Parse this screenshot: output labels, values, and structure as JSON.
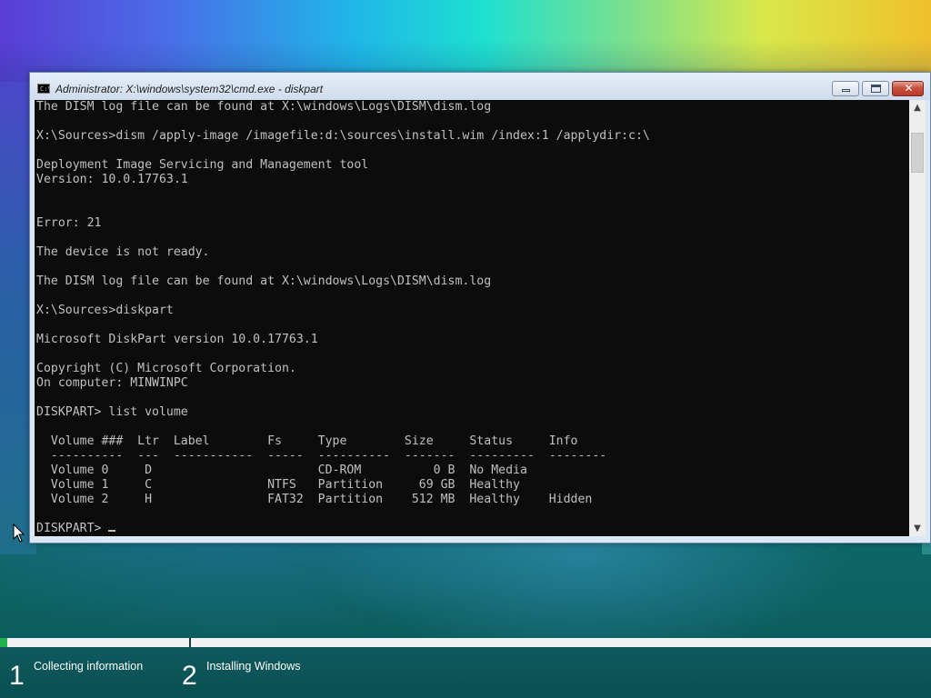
{
  "window": {
    "title": "Administrator: X:\\windows\\system32\\cmd.exe - diskpart",
    "icon_text": "C:\\",
    "close_glyph": "✕",
    "icon": "console-icon"
  },
  "console": {
    "lines": [
      "The DISM log file can be found at X:\\windows\\Logs\\DISM\\dism.log",
      "",
      "X:\\Sources>dism /apply-image /imagefile:d:\\sources\\install.wim /index:1 /applydir:c:\\",
      "",
      "Deployment Image Servicing and Management tool",
      "Version: 10.0.17763.1",
      "",
      "",
      "Error: 21",
      "",
      "The device is not ready.",
      "",
      "The DISM log file can be found at X:\\windows\\Logs\\DISM\\dism.log",
      "",
      "X:\\Sources>diskpart",
      "",
      "Microsoft DiskPart version 10.0.17763.1",
      "",
      "Copyright (C) Microsoft Corporation.",
      "On computer: MINWINPC",
      "",
      "DISKPART> list volume",
      "",
      "  Volume ###  Ltr  Label        Fs     Type        Size     Status     Info",
      "  ----------  ---  -----------  -----  ----------  -------  ---------  --------",
      "  Volume 0     D                       CD-ROM          0 B  No Media",
      "  Volume 1     C                NTFS   Partition     69 GB  Healthy",
      "  Volume 2     H                FAT32  Partition    512 MB  Healthy    Hidden",
      ""
    ],
    "prompt": "DISKPART> "
  },
  "scrollbar": {
    "up_glyph": "▲",
    "down_glyph": "▼"
  },
  "setup": {
    "progress_fraction": 0.008,
    "progress_color": "#22b14c",
    "steps": [
      {
        "number": "1",
        "label": "Collecting information"
      },
      {
        "number": "2",
        "label": "Installing Windows"
      }
    ]
  }
}
